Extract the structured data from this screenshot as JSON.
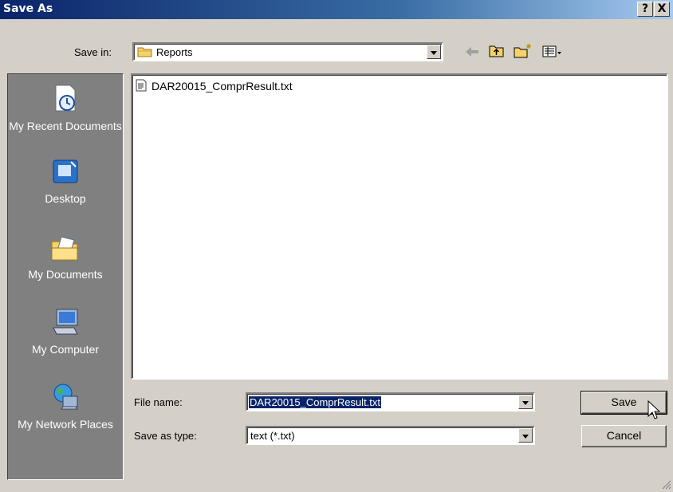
{
  "window": {
    "title": "Save As",
    "help_label": "?",
    "close_label": "X"
  },
  "toolbar": {
    "save_in_label": "Save in:",
    "save_in_value": "Reports",
    "icons": [
      "back-arrow-icon",
      "up-folder-icon",
      "new-folder-icon",
      "view-menu-icon"
    ]
  },
  "places": [
    {
      "id": "recent",
      "label": "My Recent Documents",
      "icon": "recent-documents-icon"
    },
    {
      "id": "desktop",
      "label": "Desktop",
      "icon": "desktop-icon"
    },
    {
      "id": "documents",
      "label": "My Documents",
      "icon": "my-documents-icon"
    },
    {
      "id": "computer",
      "label": "My Computer",
      "icon": "my-computer-icon"
    },
    {
      "id": "network",
      "label": "My Network Places",
      "icon": "network-places-icon"
    }
  ],
  "files": [
    {
      "name": "DAR20015_ComprResult.txt",
      "icon": "text-file-icon"
    }
  ],
  "form": {
    "file_name_label": "File name:",
    "file_name_value": "DAR20015_ComprResult.txt",
    "save_type_label": "Save as type:",
    "save_type_value": "text (*.txt)"
  },
  "buttons": {
    "save": "Save",
    "cancel": "Cancel"
  },
  "colors": {
    "title_start": "#0a246a",
    "title_end": "#a6caf0",
    "face": "#d4d0c8",
    "selection": "#0a246a"
  }
}
